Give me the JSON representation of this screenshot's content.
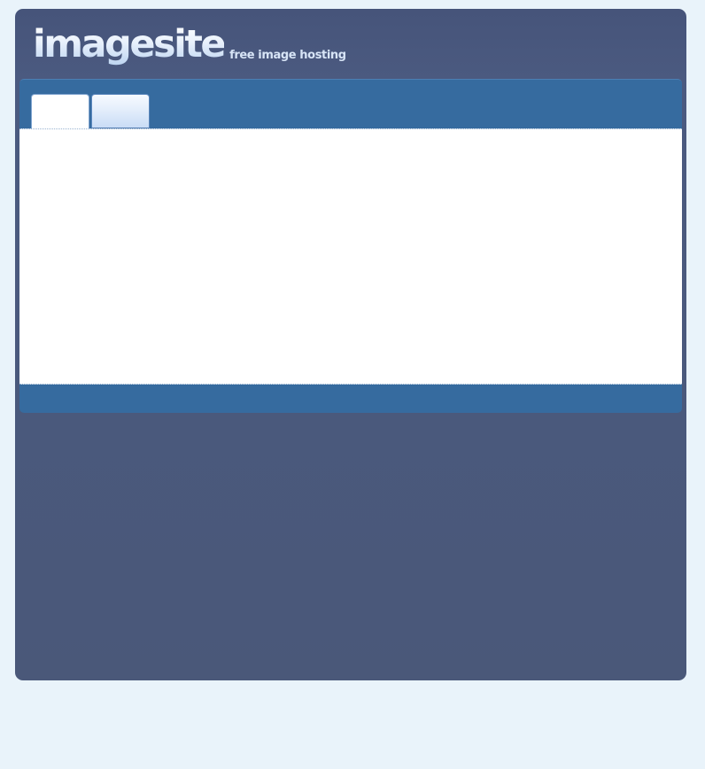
{
  "logo": {
    "word": "imagesite",
    "tagline": "free image hosting"
  },
  "tabs": [
    {
      "label": "",
      "active": true
    },
    {
      "label": "",
      "active": false
    }
  ],
  "colors": {
    "page_background": "#e9f3fa",
    "frame_background": "#4a5879",
    "panel_background": "#366b9f",
    "content_background": "#ffffff"
  }
}
